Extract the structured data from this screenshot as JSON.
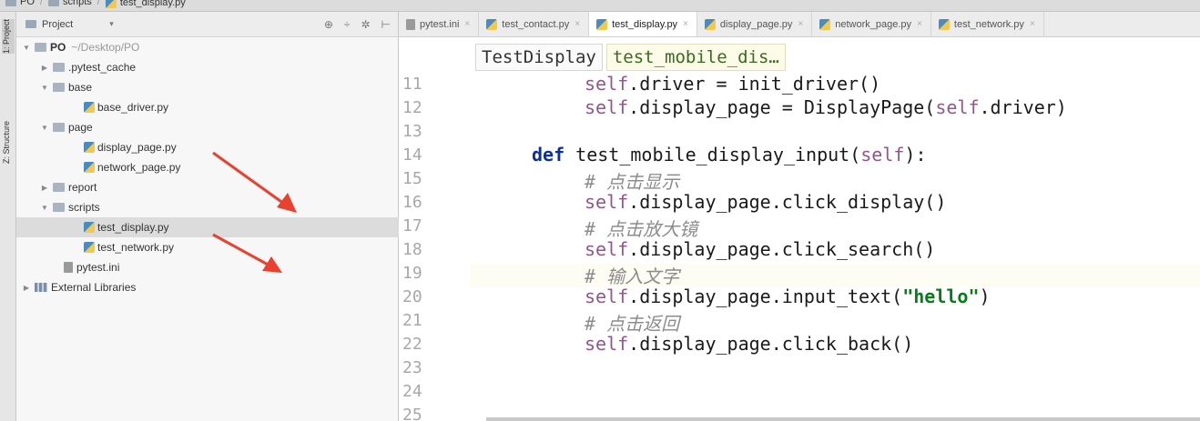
{
  "breadcrumb": {
    "items": [
      "PO",
      "scripts",
      "test_display.py"
    ]
  },
  "toolstrip": {
    "project_tab": "1: Project",
    "structure_tab": "Z: Structure"
  },
  "project_panel": {
    "title": "Project",
    "tree": [
      {
        "label": "PO",
        "hint": "~/Desktop/PO",
        "type": "folder"
      },
      {
        "label": ".pytest_cache",
        "type": "folder"
      },
      {
        "label": "base",
        "type": "folder"
      },
      {
        "label": "base_driver.py",
        "type": "py"
      },
      {
        "label": "page",
        "type": "folder"
      },
      {
        "label": "display_page.py",
        "type": "py"
      },
      {
        "label": "network_page.py",
        "type": "py"
      },
      {
        "label": "report",
        "type": "folder"
      },
      {
        "label": "scripts",
        "type": "folder"
      },
      {
        "label": "test_display.py",
        "type": "py"
      },
      {
        "label": "test_network.py",
        "type": "py"
      },
      {
        "label": "pytest.ini",
        "type": "ini"
      },
      {
        "label": "External Libraries",
        "type": "lib"
      }
    ]
  },
  "tabs": [
    {
      "label": "pytest.ini"
    },
    {
      "label": "test_contact.py"
    },
    {
      "label": "test_display.py"
    },
    {
      "label": "display_page.py"
    },
    {
      "label": "network_page.py"
    },
    {
      "label": "test_network.py"
    }
  ],
  "editor": {
    "crumb_class": "TestDisplay",
    "crumb_method": "test_mobile_dis…",
    "line_numbers": [
      "11",
      "12",
      "13",
      "14",
      "15",
      "16",
      "17",
      "18",
      "19",
      "20",
      "21",
      "22",
      "23",
      "24",
      "25"
    ],
    "code": {
      "l11_self": "self",
      "l11_rest": ".driver = init_driver()",
      "l12_self": "self",
      "l12_mid": ".display_page = DisplayPage(",
      "l12_self2": "self",
      "l12_end": ".driver)",
      "l14_kw": "def",
      "l14_name": " test_mobile_display_input(",
      "l14_self": "self",
      "l14_end": "):",
      "l15": "# 点击显示",
      "l16_self": "self",
      "l16_rest": ".display_page.click_display()",
      "l17": "# 点击放大镜",
      "l18_self": "self",
      "l18_rest": ".display_page.click_search()",
      "l19": "# 输入文字",
      "l20_self": "self",
      "l20_mid": ".display_page.input_text(",
      "l20_str": "\"hello\"",
      "l20_end": ")",
      "l21": "# 点击返回",
      "l22_self": "self",
      "l22_rest": ".display_page.click_back()"
    }
  },
  "colors": {
    "keyword": "#0b2fa0",
    "self": "#94558d",
    "string": "#067d17",
    "comment": "#8c8c8c",
    "annotation_arrow": "#e8412f"
  }
}
